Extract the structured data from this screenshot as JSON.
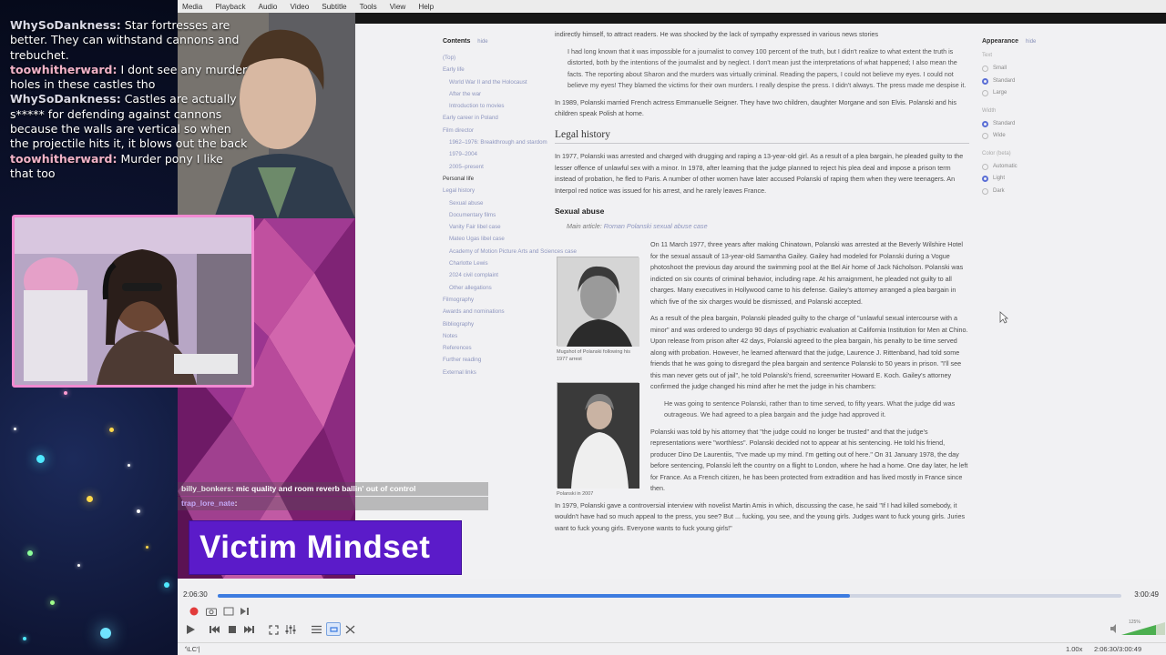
{
  "chat": [
    {
      "user": "WhySoDankness:",
      "text": "Star fortresses are better. They can withstand cannons and trebuchet.",
      "faint": true
    },
    {
      "user": "toowhitherward:",
      "text": "I dont see any murder holes in these castles tho",
      "faint": false
    },
    {
      "user": "WhySoDankness:",
      "text": "Castles are actually s***** for defending against cannons because the walls are vertical so when the projectile hits it, it blows out the back",
      "faint": true
    },
    {
      "user": "toowhitherward:",
      "text": "Murder pony I like that too",
      "faint": false
    }
  ],
  "menubar": [
    "Media",
    "Playback",
    "Audio",
    "Video",
    "Subtitle",
    "Tools",
    "View",
    "Help"
  ],
  "toc": {
    "title": "Contents",
    "hide": "hide",
    "items": [
      {
        "label": "(Top)",
        "level": 0
      },
      {
        "label": "Early life",
        "level": 0
      },
      {
        "label": "World War II and the Holocaust",
        "level": 1
      },
      {
        "label": "After the war",
        "level": 1
      },
      {
        "label": "Introduction to movies",
        "level": 1
      },
      {
        "label": "Early career in Poland",
        "level": 0
      },
      {
        "label": "Film director",
        "level": 0
      },
      {
        "label": "1962–1976: Breakthrough and stardom",
        "level": 1
      },
      {
        "label": "1979–2004",
        "level": 1
      },
      {
        "label": "2005–present",
        "level": 1
      },
      {
        "label": "Personal life",
        "level": 0,
        "active": true
      },
      {
        "label": "Legal history",
        "level": 0
      },
      {
        "label": "Sexual abuse",
        "level": 1
      },
      {
        "label": "Documentary films",
        "level": 1
      },
      {
        "label": "Vanity Fair libel case",
        "level": 1
      },
      {
        "label": "Mateo Ugas libel case",
        "level": 1
      },
      {
        "label": "Academy of Motion Picture Arts and Sciences case",
        "level": 1
      },
      {
        "label": "Charlotte Lewis",
        "level": 1
      },
      {
        "label": "2024 civil complaint",
        "level": 1
      },
      {
        "label": "Other allegations",
        "level": 1
      },
      {
        "label": "Filmography",
        "level": 0
      },
      {
        "label": "Awards and nominations",
        "level": 0
      },
      {
        "label": "Bibliography",
        "level": 0
      },
      {
        "label": "Notes",
        "level": 0
      },
      {
        "label": "References",
        "level": 0
      },
      {
        "label": "Further reading",
        "level": 0
      },
      {
        "label": "External links",
        "level": 0
      }
    ]
  },
  "article": {
    "intro": "indirectly himself, to attract readers. He was shocked by the lack of sympathy expressed in various news stories",
    "quote1": "I had long known that it was impossible for a journalist to convey 100 percent of the truth, but I didn't realize to what extent the truth is distorted, both by the intentions of the journalist and by neglect. I don't mean just the interpretations of what happened; I also mean the facts. The reporting about Sharon and the murders was virtually criminal. Reading the papers, I could not believe my eyes. I could not believe my eyes! They blamed the victims for their own murders. I really despise the press. I didn't always. The press made me despise it.",
    "marriage": "In 1989, Polanski married French actress Emmanuelle Seigner. They have two children, daughter Morgane and son Elvis. Polanski and his children speak Polish at home.",
    "legal_heading": "Legal history",
    "legal_p": "In 1977, Polanski was arrested and charged with drugging and raping a 13-year-old girl. As a result of a plea bargain, he pleaded guilty to the lesser offence of unlawful sex with a minor. In 1978, after learning that the judge planned to reject his plea deal and impose a prison term instead of probation, he fled to Paris. A number of other women have later accused Polanski of raping them when they were teenagers. An Interpol red notice was issued for his arrest, and he rarely leaves France.",
    "sexual_heading": "Sexual abuse",
    "main_article_label": "Main article:",
    "main_article_link": "Roman Polanski sexual abuse case",
    "p_arrest": "On 11 March 1977, three years after making Chinatown, Polanski was arrested at the Beverly Wilshire Hotel for the sexual assault of 13-year-old Samantha Gailey. Gailey had modeled for Polanski during a Vogue photoshoot the previous day around the swimming pool at the Bel Air home of Jack Nicholson. Polanski was indicted on six counts of criminal behavior, including rape. At his arraignment, he pleaded not guilty to all charges. Many executives in Hollywood came to his defense. Gailey's attorney arranged a plea bargain in which five of the six charges would be dismissed, and Polanski accepted.",
    "p_plea": "As a result of the plea bargain, Polanski pleaded guilty to the charge of \"unlawful sexual intercourse with a minor\" and was ordered to undergo 90 days of psychiatric evaluation at California Institution for Men at Chino. Upon release from prison after 42 days, Polanski agreed to the plea bargain, his penalty to be time served along with probation. However, he learned afterward that the judge, Laurence J. Rittenband, had told some friends that he was going to disregard the plea bargain and sentence Polanski to 50 years in prison. \"I'll see this man never gets out of jail\", he told Polanski's friend, screenwriter Howard E. Koch. Gailey's attorney confirmed the judge changed his mind after he met the judge in his chambers:",
    "quote2": "He was going to sentence Polanski, rather than to time served, to fifty years. What the judge did was outrageous. We had agreed to a plea bargain and the judge had approved it.",
    "p_worthless": "Polanski was told by his attorney that \"the judge could no longer be trusted\" and that the judge's representations were \"worthless\". Polanski decided not to appear at his sentencing. He told his friend, producer Dino De Laurentiis, \"I've made up my mind. I'm getting out of here.\" On 31 January 1978, the day before sentencing, Polanski left the country on a flight to London, where he had a home. One day later, he left for France. As a French citizen, he has been protected from extradition and has lived mostly in France since then.",
    "p_amis": "In 1979, Polanski gave a controversial interview with novelist Martin Amis in which, discussing the case, he said \"If I had killed somebody, it wouldn't have had so much appeal to the press, you see? But ... fucking, you see, and the young girls. Judges want to fuck young girls. Juries want to fuck young girls. Everyone wants to fuck young girls!\"",
    "fig1_caption": "Mugshot of Polanski following his 1977 arrest",
    "fig2_caption": "Polanski in 2007"
  },
  "appearance": {
    "title": "Appearance",
    "hide": "hide",
    "text_label": "Text",
    "text_options": [
      "Small",
      "Standard",
      "Large"
    ],
    "text_selected": 1,
    "width_label": "Width",
    "width_options": [
      "Standard",
      "Wide"
    ],
    "width_selected": 0,
    "color_label": "Color (beta)",
    "color_options": [
      "Automatic",
      "Light",
      "Dark"
    ],
    "color_selected": 1
  },
  "overlay_chat": [
    {
      "user": "billy_bonkers",
      "text": ": mic quality and room reverb ballin' out of control"
    },
    {
      "user": "trap_lore_nate",
      "text": ":"
    }
  ],
  "banner_title": "Victim Mindset",
  "player": {
    "current_time": "2:06:30",
    "total_time": "3:00:49",
    "progress": 0.7,
    "codec": "'\\LC'|",
    "speed": "1.00x",
    "time_info": "2:06:30/3:00:49",
    "volume_label": "125%"
  },
  "colors": {
    "banner": "#5b1bc9",
    "seek_fill": "#3d7ce0",
    "webcam_border": "#f18ad2",
    "chat_user": "#f2b3c8"
  }
}
